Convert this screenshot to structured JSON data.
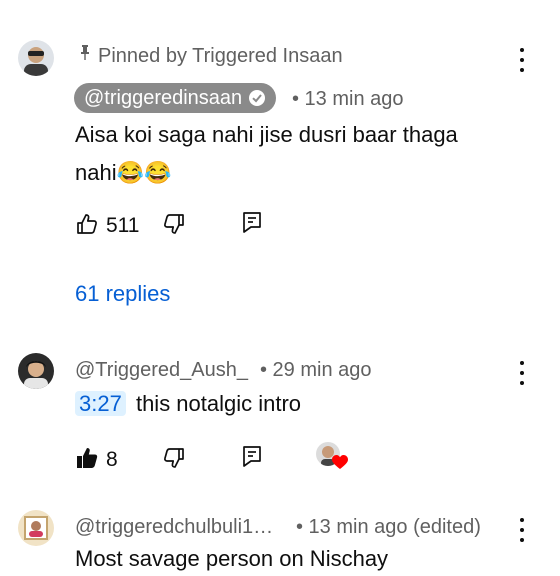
{
  "comments": [
    {
      "pinned_text": "Pinned by Triggered Insaan",
      "author": "@triggeredinsaan",
      "time": "• 13 min ago",
      "text_line1": "Aisa koi saga nahi jise dusri baar thaga",
      "text_line2": "nahi😂😂",
      "likes": "511",
      "replies": "61 replies"
    },
    {
      "author": "@Triggered_Aush_",
      "time": "• 29 min ago",
      "timestamp": "3:27",
      "text": "this notalgic intro",
      "likes": "8"
    },
    {
      "author": "@triggeredchulbuli1…",
      "time": "• 13 min ago (edited)",
      "text_partial": "Most savage person on Nischay"
    }
  ],
  "colors": {
    "link": "#065fd4",
    "muted": "#606060",
    "chip": "#8a8a8a",
    "heart": "#ff0000"
  }
}
